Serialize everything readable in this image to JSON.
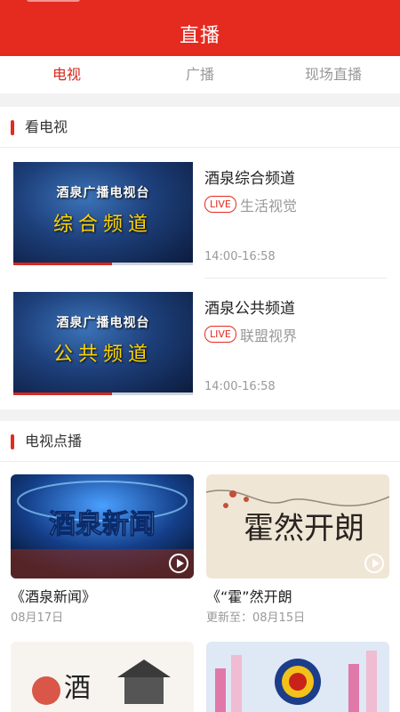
{
  "header": {
    "title": "直播"
  },
  "tabs": [
    {
      "label": "电视",
      "active": true
    },
    {
      "label": "广播",
      "active": false
    },
    {
      "label": "现场直播",
      "active": false
    }
  ],
  "tv_section": {
    "title": "看电视",
    "channels": [
      {
        "thumb_station": "酒泉广播电视台",
        "thumb_channel": "综合频道",
        "name": "酒泉综合频道",
        "badge": "LIVE",
        "program": "生活视觉",
        "time": "14:00-16:58",
        "progress": 0.55
      },
      {
        "thumb_station": "酒泉广播电视台",
        "thumb_channel": "公共频道",
        "name": "酒泉公共频道",
        "badge": "LIVE",
        "program": "联盟视界",
        "time": "14:00-16:58",
        "progress": 0.55
      }
    ]
  },
  "vod_section": {
    "title": "电视点播",
    "items": [
      {
        "thumb_text": "酒泉新闻",
        "title": "《酒泉新闻》",
        "date": "08月17日"
      },
      {
        "thumb_text": "霍然开朗",
        "title": "《“霍”然开朗",
        "date": "更新至：08月15日"
      },
      {
        "thumb_text": "酒",
        "title": "",
        "date": ""
      },
      {
        "thumb_text": "",
        "title": "",
        "date": ""
      }
    ]
  },
  "colors": {
    "brand": "#e52a1f",
    "active_tab": "#d9261c"
  }
}
